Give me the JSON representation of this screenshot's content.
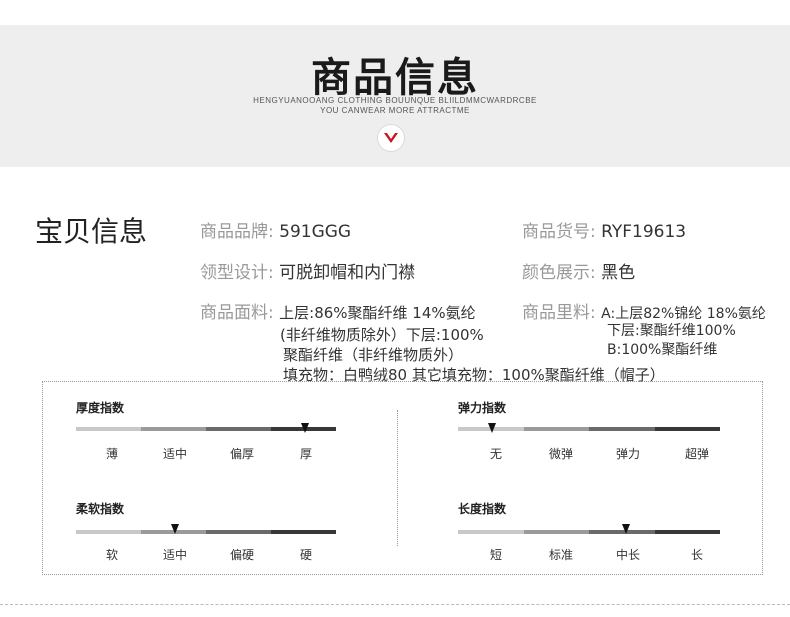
{
  "header": {
    "title": "商品信息",
    "subtitle_line1": "HENGYUANOOANG CLOTHING BOUUNQUE BLIILDMMCWARDRCBE",
    "subtitle_line2": "YOU CANWEAR MORE ATTRACTME",
    "badge_icon": "chevron-down-icon",
    "accent_color": "#c7161e"
  },
  "product": {
    "section_title": "宝贝信息",
    "brand_label": "商品品牌:",
    "brand_value": "591GGG",
    "sku_label": "商品货号:",
    "sku_value": "RYF19613",
    "collar_label": "领型设计:",
    "collar_value": "可脱卸帽和内门襟",
    "color_label": "颜色展示:",
    "color_value": "黑色",
    "fabric_label": "商品面料:",
    "fabric_lines": [
      "上层:86%聚酯纤维 14%氨纶",
      "(非纤维物质除外）下层:100%",
      "聚酯纤维（非纤维物质外）",
      "填充物：白鸭绒80 其它填充物：100%聚酯纤维（帽子）"
    ],
    "lining_label": "商品里料:",
    "lining_lines": [
      "A:上层82%锦纶 18%氨纶",
      "下层:聚酯纤维100%",
      "B:100%聚酯纤维"
    ]
  },
  "indices": {
    "thickness": {
      "title": "厚度指数",
      "levels": [
        "薄",
        "适中",
        "偏厚",
        "厚"
      ],
      "selected_level": 4,
      "marker_fraction": 0.88
    },
    "elasticity": {
      "title": "弹力指数",
      "levels": [
        "无",
        "微弹",
        "弹力",
        "超弹"
      ],
      "selected_level": 1,
      "marker_fraction": 0.13
    },
    "softness": {
      "title": "柔软指数",
      "levels": [
        "软",
        "适中",
        "偏硬",
        "硬"
      ],
      "selected_level": 2,
      "marker_fraction": 0.38
    },
    "length": {
      "title": "长度指数",
      "levels": [
        "短",
        "标准",
        "中长",
        "长"
      ],
      "selected_level": 3,
      "marker_fraction": 0.64
    }
  }
}
